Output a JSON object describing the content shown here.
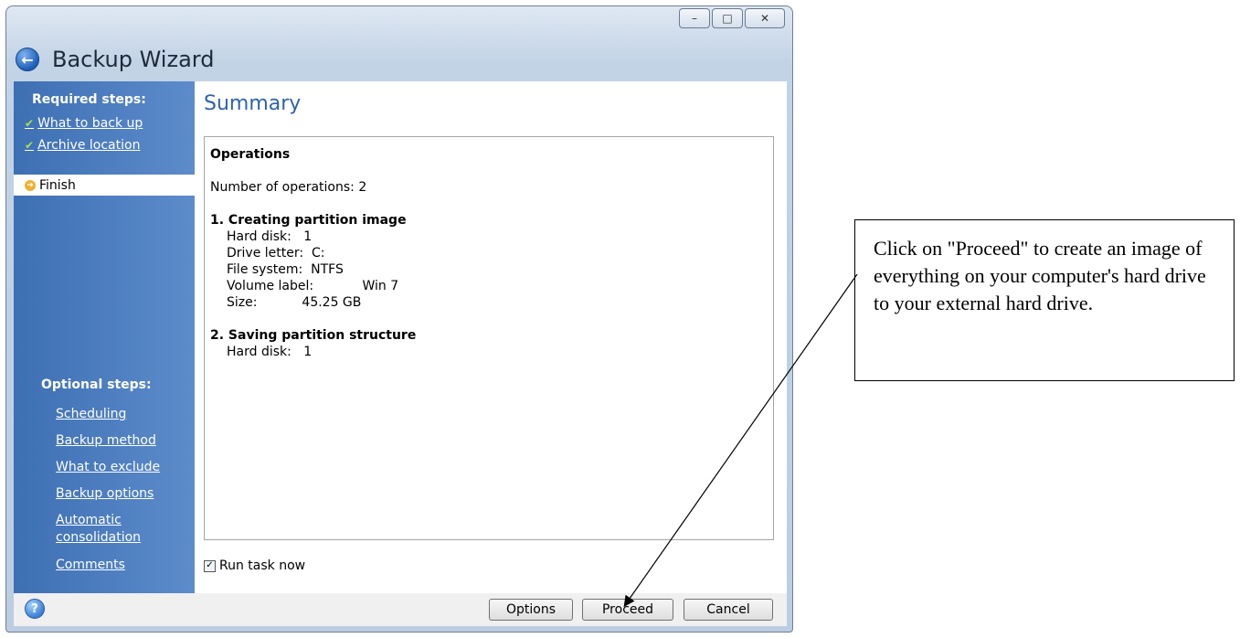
{
  "window": {
    "title": "Backup Wizard",
    "controls": {
      "minimize": "–",
      "maximize": "□",
      "close": "✕"
    }
  },
  "sidebar": {
    "required_heading": "Required steps:",
    "required_steps": [
      {
        "label": "What to back up",
        "done": true
      },
      {
        "label": "Archive location",
        "done": true
      },
      {
        "label": "Finish",
        "current": true
      }
    ],
    "optional_heading": "Optional steps:",
    "optional_steps": [
      "Scheduling",
      "Backup method",
      "What to exclude",
      "Backup options",
      "Automatic",
      "consolidation",
      "Comments"
    ]
  },
  "main": {
    "title": "Summary",
    "operations_heading": "Operations",
    "number_of_operations": "Number of operations: 2",
    "op1": {
      "title": "1. Creating partition image",
      "details": [
        "Hard disk:   1",
        "Drive letter:  C:",
        "File system:  NTFS",
        "Volume label:            Win 7",
        "Size:           45.25 GB"
      ]
    },
    "op2": {
      "title": "2. Saving partition structure",
      "details": [
        "Hard disk:   1"
      ]
    },
    "run_task_now": "Run task now",
    "run_task_now_checked": true
  },
  "buttons": {
    "options": "Options",
    "proceed": "Proceed",
    "cancel": "Cancel"
  },
  "annotation": {
    "text": "Click on \"Proceed\" to create an image of everything on your computer's hard drive to your external hard drive."
  },
  "colors": {
    "sidebar": "#4a7cc0",
    "title_blue": "#2d63ad",
    "check_green": "#a6e04a"
  }
}
